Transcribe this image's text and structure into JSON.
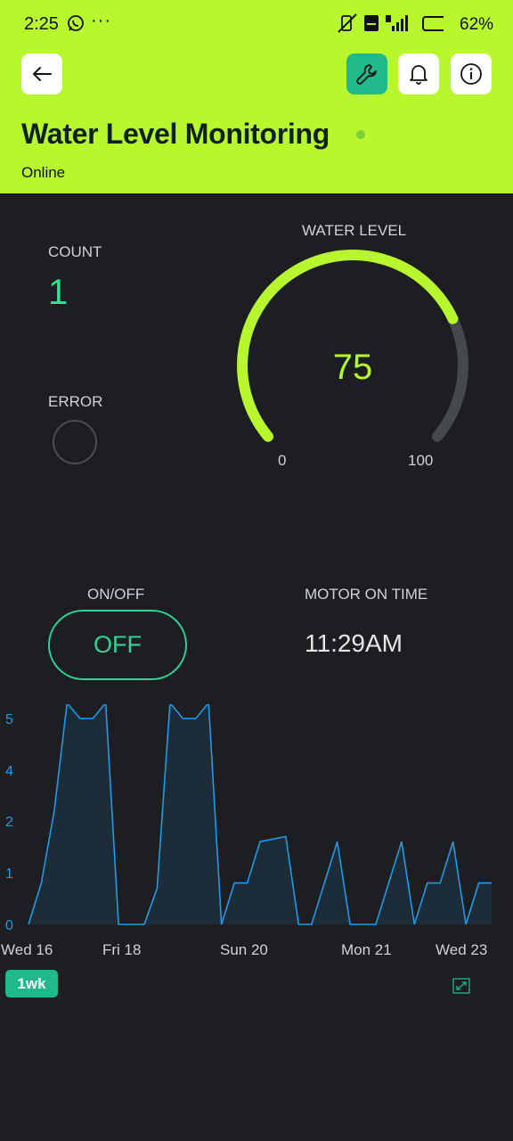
{
  "status_bar": {
    "time": "2:25",
    "more": "···",
    "battery_pct": "62%"
  },
  "header": {
    "title": "Water Level Monitoring",
    "status": "Online"
  },
  "count": {
    "label": "COUNT",
    "value": "1"
  },
  "error": {
    "label": "ERROR"
  },
  "gauge": {
    "label": "WATER LEVEL",
    "value": "75",
    "min": "0",
    "max": "100",
    "level": 75
  },
  "switch": {
    "label": "ON/OFF",
    "state": "OFF"
  },
  "motor": {
    "label": "MOTOR ON TIME",
    "time": "11:29AM"
  },
  "chart_data": {
    "type": "area",
    "y_ticks": [
      "5",
      "4",
      "2",
      "1",
      "0"
    ],
    "x_ticks": [
      "Wed 16",
      "Fri 18",
      "Sun 20",
      "Mon 21",
      "Wed 23"
    ],
    "series": [
      {
        "values": [
          0,
          0.8,
          2.4,
          5.3,
          5,
          5,
          5.3,
          0,
          0,
          0,
          0.7,
          5.3,
          5,
          5,
          5.3,
          0,
          0.8,
          0.8,
          1.6,
          1.65,
          1.7,
          0,
          0,
          0.8,
          1.6,
          0,
          0,
          0,
          0.8,
          1.6,
          0,
          0.8,
          0.8,
          1.6,
          0,
          0.8,
          0.8
        ]
      }
    ]
  },
  "range": {
    "label": "1wk"
  },
  "colors": {
    "accent": "#b8f72e",
    "teal": "#20b98a",
    "line": "#1e9be8",
    "bg": "#1c1e22"
  }
}
